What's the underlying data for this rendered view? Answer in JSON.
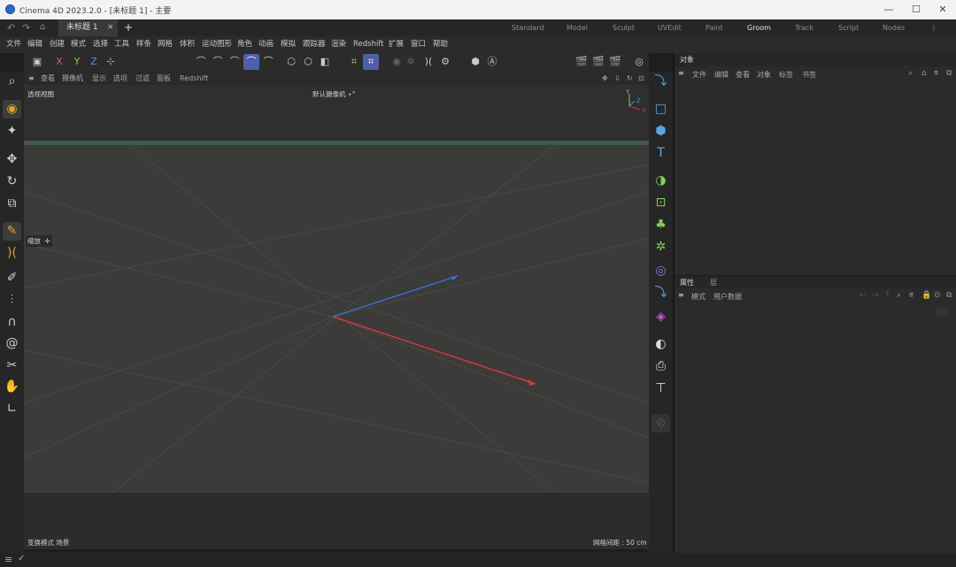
{
  "window": {
    "title": "Cinema 4D 2023.2.0 - [未标题 1] - 主要",
    "minimize": "—",
    "maximize": "☐",
    "close": "✕"
  },
  "tabbar": {
    "document_tab": "未标题 1",
    "close_glyph": "×",
    "add_glyph": "+",
    "layouts": [
      "Standard",
      "Model",
      "Sculpt",
      "UVEdit",
      "Paint",
      "Groom",
      "Track",
      "Script",
      "Nodes"
    ],
    "active_layout": "Groom",
    "more_glyph": "⋮"
  },
  "menubar": {
    "items": [
      "文件",
      "编辑",
      "创建",
      "模式",
      "选择",
      "工具",
      "样条",
      "网格",
      "体积",
      "运动图形",
      "角色",
      "动画",
      "模拟",
      "跟踪器",
      "渲染",
      "Redshift",
      "扩展",
      "窗口",
      "帮助"
    ]
  },
  "viewport": {
    "menu": [
      "查看",
      "摄像机",
      "显示",
      "选项",
      "过滤",
      "面板",
      "Redshift"
    ],
    "view_name": "透视视图",
    "camera": "默认摄像机 ∙°",
    "bottom_left": "变换模式  场景",
    "grid_spacing": "网格间距 : 50 cm",
    "handle_label": "缩放",
    "axis_y": "Y",
    "axis_x": "X",
    "axis_z": "Z"
  },
  "object_panel": {
    "tab": "对象",
    "menu": [
      "文件",
      "编辑",
      "查看",
      "对象",
      "标签",
      "书签"
    ]
  },
  "attribute_panel": {
    "tabs": [
      "属性",
      "层"
    ],
    "menu": [
      "模式",
      "用户数据"
    ]
  },
  "colors": {
    "accent": "#4a7fd6",
    "x_axis": "#d23a3a",
    "y_axis": "#3a8fd2",
    "z_axis": "#3a6fd2",
    "toolbar_active": "#4f5fa8",
    "viewport_bg": "#3a3a38",
    "horizon": "#3f5a45"
  },
  "icons": {
    "undo": "undo-icon",
    "redo": "redo-icon",
    "home": "home-icon"
  }
}
